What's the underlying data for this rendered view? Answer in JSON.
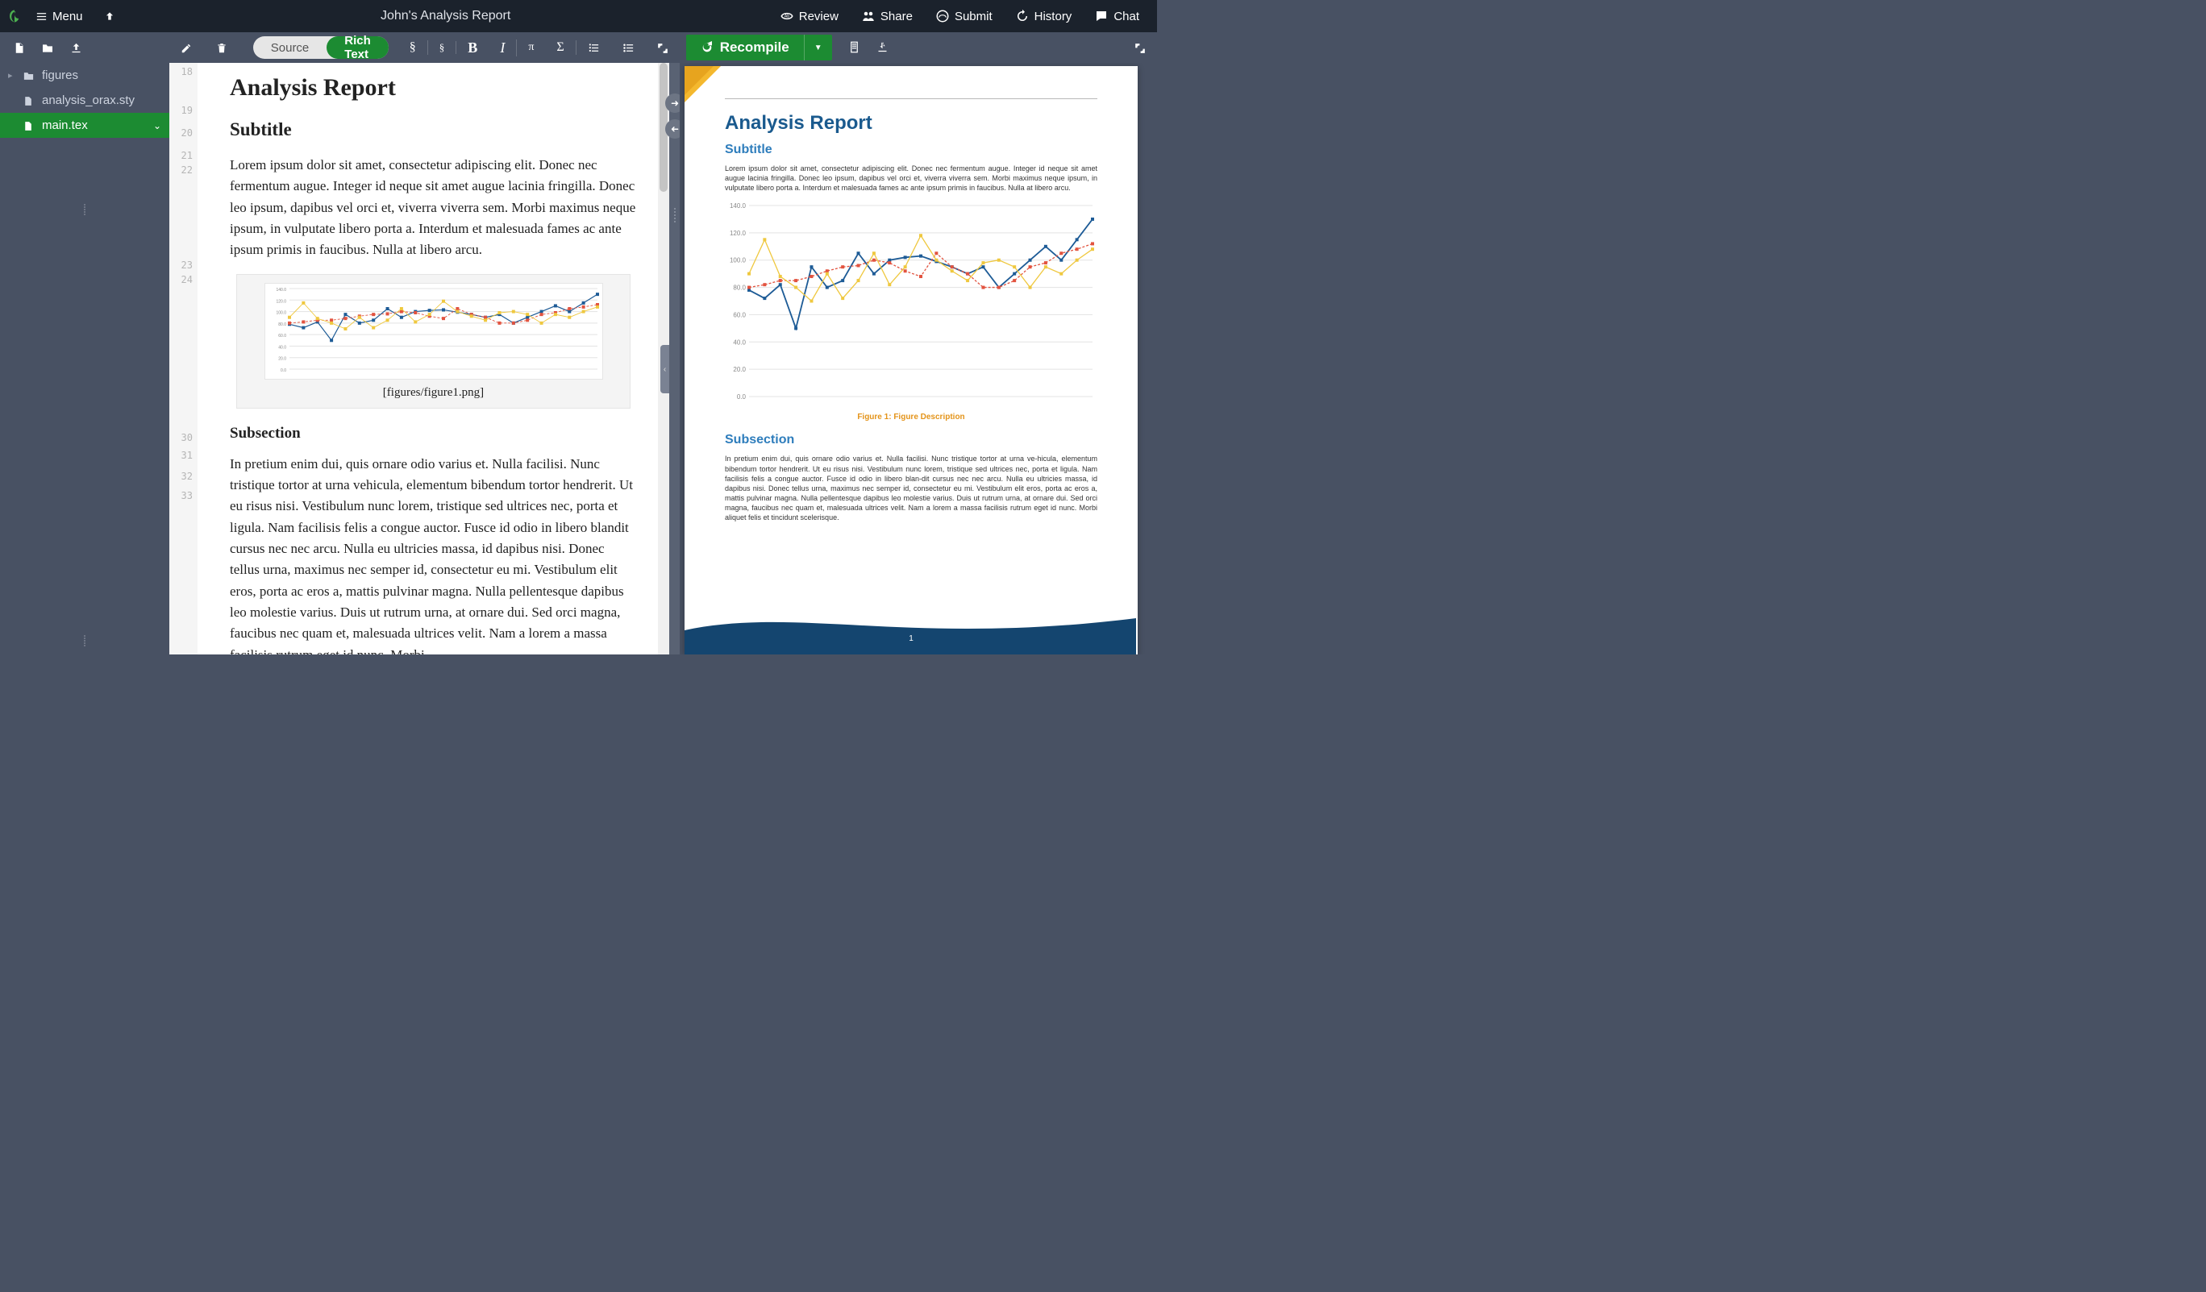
{
  "header": {
    "menu": "Menu",
    "title": "John's Analysis Report",
    "actions": {
      "review": "Review",
      "share": "Share",
      "submit": "Submit",
      "history": "History",
      "chat": "Chat"
    }
  },
  "toolbar": {
    "source": "Source",
    "richtext": "Rich Text",
    "recompile": "Recompile"
  },
  "files": {
    "folder_figures": "figures",
    "analysis_sty": "analysis_orax.sty",
    "main": "main.tex"
  },
  "editor": {
    "line_numbers": [
      18,
      19,
      20,
      21,
      22,
      23,
      24,
      30,
      31,
      32,
      33
    ],
    "ln_tops": [
      4,
      52,
      80,
      108,
      126,
      244,
      262,
      458,
      480,
      506,
      530
    ],
    "title": "Analysis Report",
    "subtitle": "Subtitle",
    "para1": "Lorem ipsum dolor sit amet, consectetur adipiscing elit. Donec nec fermentum augue. Integer id neque sit amet augue lacinia fringilla. Donec leo ipsum, dapibus vel orci et, viverra viverra sem. Morbi maximus neque ipsum, in vulputate libero porta a. Interdum et malesuada fames ac ante ipsum primis in faucibus. Nulla at libero arcu.",
    "figcaption": "[figures/figure1.png]",
    "subsection": "Subsection",
    "para2": "In pretium enim dui, quis ornare odio varius et. Nulla facilisi. Nunc tristique tortor at urna vehicula, elementum bibendum tortor hendrerit. Ut eu risus nisi. Vestibulum nunc lorem, tristique sed ultrices nec, porta et ligula. Nam facilisis felis a congue auctor. Fusce id odio in libero blandit cursus nec nec arcu. Nulla eu ultricies massa, id dapibus nisi. Donec tellus urna, maximus nec semper id, consectetur eu mi. Vestibulum elit eros, porta ac eros a, mattis pulvinar magna. Nulla pellentesque dapibus leo molestie varius. Duis ut rutrum urna, at ornare dui. Sed orci magna, faucibus nec quam et, malesuada ultrices velit. Nam a lorem a massa facilisis rutrum eget id nunc. Morbi"
  },
  "pdf": {
    "title": "Analysis Report",
    "subtitle": "Subtitle",
    "para1": "Lorem ipsum dolor sit amet, consectetur adipiscing elit. Donec nec fermentum augue. Integer id neque sit amet augue lacinia fringilla. Donec leo ipsum, dapibus vel orci et, viverra viverra sem. Morbi maximus neque ipsum, in vulputate libero porta a. Interdum et malesuada fames ac ante ipsum primis in faucibus. Nulla at libero arcu.",
    "figcaption": "Figure 1: Figure Description",
    "subsection": "Subsection",
    "para2": "In pretium enim dui, quis ornare odio varius et. Nulla facilisi. Nunc tristique tortor at urna ve-hicula, elementum bibendum tortor hendrerit. Ut eu risus nisi. Vestibulum nunc lorem, tristique sed ultrices nec, porta et ligula. Nam facilisis felis a congue auctor. Fusce id odio in libero blan-dit cursus nec nec arcu. Nulla eu ultricies massa, id dapibus nisi. Donec tellus urna, maximus nec semper id, consectetur eu mi. Vestibulum elit eros, porta ac eros a, mattis pulvinar magna. Nulla pellentesque dapibus leo molestie varius. Duis ut rutrum urna, at ornare dui. Sed orci magna, faucibus nec quam et, malesuada ultrices velit. Nam a lorem a massa facilisis rutrum eget id nunc. Morbi aliquet felis et tincidunt scelerisque.",
    "page_number": "1"
  },
  "chart_data": {
    "type": "line",
    "x_index": [
      1,
      2,
      3,
      4,
      5,
      6,
      7,
      8,
      9,
      10,
      11,
      12,
      13,
      14,
      15,
      16,
      17,
      18,
      19,
      20,
      21,
      22,
      23
    ],
    "ylabels": [
      "0.0",
      "20.0",
      "40.0",
      "60.0",
      "80.0",
      "100.0",
      "120.0",
      "140.0"
    ],
    "ylim": [
      0,
      140
    ],
    "series": [
      {
        "name": "blue",
        "values": [
          78,
          72,
          82,
          50,
          95,
          80,
          85,
          105,
          90,
          100,
          102,
          103,
          99,
          95,
          90,
          95,
          80,
          90,
          100,
          110,
          100,
          115,
          130
        ]
      },
      {
        "name": "red",
        "values": [
          80,
          82,
          85,
          85,
          88,
          92,
          95,
          96,
          100,
          98,
          92,
          88,
          105,
          95,
          90,
          80,
          80,
          85,
          95,
          98,
          105,
          108,
          112
        ]
      },
      {
        "name": "yellow",
        "values": [
          90,
          115,
          88,
          80,
          70,
          90,
          72,
          85,
          105,
          82,
          95,
          118,
          100,
          92,
          85,
          98,
          100,
          95,
          80,
          95,
          90,
          100,
          108
        ]
      }
    ],
    "title": "",
    "xlabel": "",
    "ylabel": ""
  }
}
